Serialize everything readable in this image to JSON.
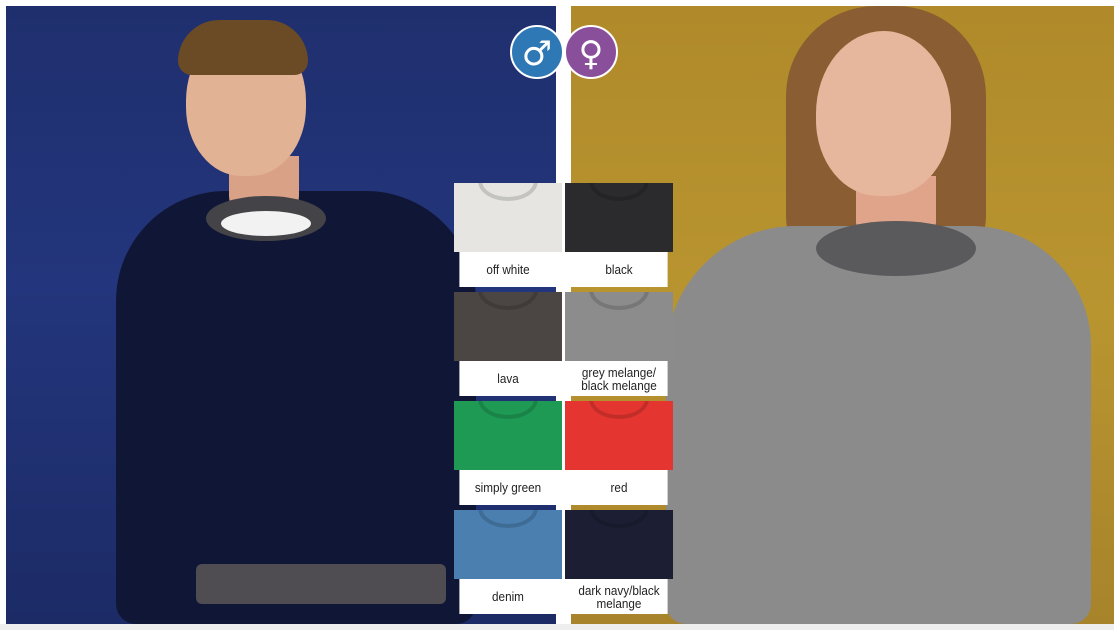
{
  "gender_icons": [
    {
      "name": "male",
      "glyph": "♂",
      "color": "#2f78b6"
    },
    {
      "name": "female",
      "glyph": "♀",
      "color": "#8a4f9b"
    }
  ],
  "swatches": [
    {
      "label": "off white",
      "color": "#e6e5e1"
    },
    {
      "label": "black",
      "color": "#2b2b2d"
    },
    {
      "label": "lava",
      "color": "#4b4644"
    },
    {
      "label": "grey melange/\nblack melange",
      "color": "#8d8c8d"
    },
    {
      "label": "simply green",
      "color": "#1e9a55"
    },
    {
      "label": "red",
      "color": "#e53530"
    },
    {
      "label": "denim",
      "color": "#4a7fb0"
    },
    {
      "label": "dark navy/black\nmelange",
      "color": "#1c1f33"
    }
  ],
  "colors": {
    "left_background": "#23357c",
    "right_background": "#b99530"
  }
}
